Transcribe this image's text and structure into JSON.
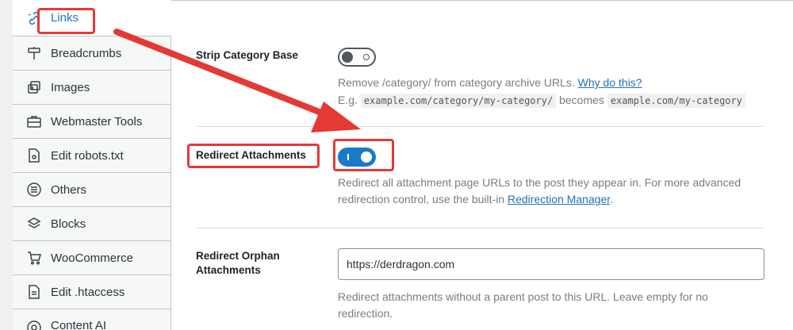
{
  "sidebar": {
    "items": [
      {
        "label": "Links",
        "icon": "link-icon",
        "active": true
      },
      {
        "label": "Breadcrumbs",
        "icon": "signpost-icon"
      },
      {
        "label": "Images",
        "icon": "images-icon"
      },
      {
        "label": "Webmaster Tools",
        "icon": "toolbox-icon"
      },
      {
        "label": "Edit robots.txt",
        "icon": "robots-file-icon"
      },
      {
        "label": "Others",
        "icon": "list-circle-icon"
      },
      {
        "label": "Blocks",
        "icon": "blocks-icon"
      },
      {
        "label": "WooCommerce",
        "icon": "cart-icon"
      },
      {
        "label": "Edit .htaccess",
        "icon": "htaccess-file-icon"
      },
      {
        "label": "Content AI",
        "icon": "content-ai-icon"
      }
    ]
  },
  "settings": {
    "strip_category": {
      "label": "Strip Category Base",
      "enabled": false,
      "desc_prefix": "Remove /category/ from category archive URLs.",
      "desc_link": "Why do this?",
      "example_prefix": "E.g.",
      "example_from": "example.com/category/my-category/",
      "example_mid": "becomes",
      "example_to": "example.com/my-category"
    },
    "redirect_attachments": {
      "label": "Redirect Attachments",
      "enabled": true,
      "desc_prefix": "Redirect all attachment page URLs to the post they appear in. For more advanced redirection control, use the built-in",
      "desc_link": "Redirection Manager",
      "desc_suffix": "."
    },
    "redirect_orphan": {
      "label_line1": "Redirect Orphan",
      "label_line2": "Attachments",
      "value": "https://derdragon.com",
      "desc": "Redirect attachments without a parent post to this URL. Leave empty for no redirection."
    }
  },
  "colors": {
    "accent": "#1a7ac9",
    "annotation": "#e53935"
  }
}
